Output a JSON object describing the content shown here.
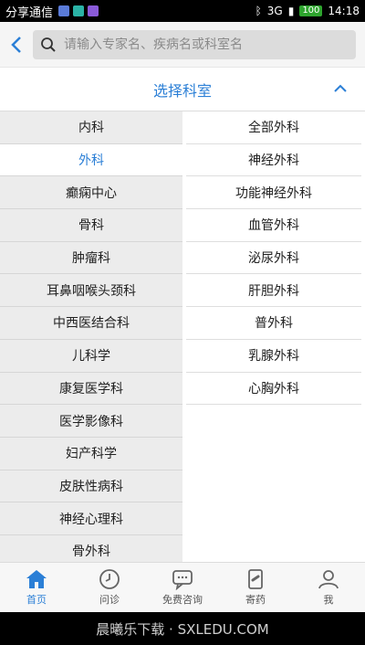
{
  "status_bar": {
    "carrier": "分享通信",
    "signal": "3G",
    "battery": "100",
    "time": "14:18"
  },
  "search": {
    "placeholder": "请输入专家名、疾病名或科室名"
  },
  "header": {
    "title": "选择科室"
  },
  "left_departments": [
    {
      "label": "内科",
      "active": false
    },
    {
      "label": "外科",
      "active": true
    },
    {
      "label": "癫痫中心",
      "active": false
    },
    {
      "label": "骨科",
      "active": false
    },
    {
      "label": "肿瘤科",
      "active": false
    },
    {
      "label": "耳鼻咽喉头颈科",
      "active": false
    },
    {
      "label": "中西医结合科",
      "active": false
    },
    {
      "label": "儿科学",
      "active": false
    },
    {
      "label": "康复医学科",
      "active": false
    },
    {
      "label": "医学影像科",
      "active": false
    },
    {
      "label": "妇产科学",
      "active": false
    },
    {
      "label": "皮肤性病科",
      "active": false
    },
    {
      "label": "神经心理科",
      "active": false
    },
    {
      "label": "骨外科",
      "active": false
    }
  ],
  "right_departments": [
    "全部外科",
    "神经外科",
    "功能神经外科",
    "血管外科",
    "泌尿外科",
    "肝胆外科",
    "普外科",
    "乳腺外科",
    "心胸外科"
  ],
  "tabs": [
    {
      "label": "首页",
      "icon": "home-icon",
      "active": true
    },
    {
      "label": "问诊",
      "icon": "clock-icon",
      "active": false
    },
    {
      "label": "免费咨询",
      "icon": "chat-icon",
      "active": false
    },
    {
      "label": "寄药",
      "icon": "medicine-icon",
      "active": false
    },
    {
      "label": "我",
      "icon": "user-icon",
      "active": false
    }
  ],
  "watermark": "晨曦乐下载 · SXLEDU.COM",
  "colors": {
    "accent": "#2b7fd6",
    "list_bg": "#ececec"
  }
}
